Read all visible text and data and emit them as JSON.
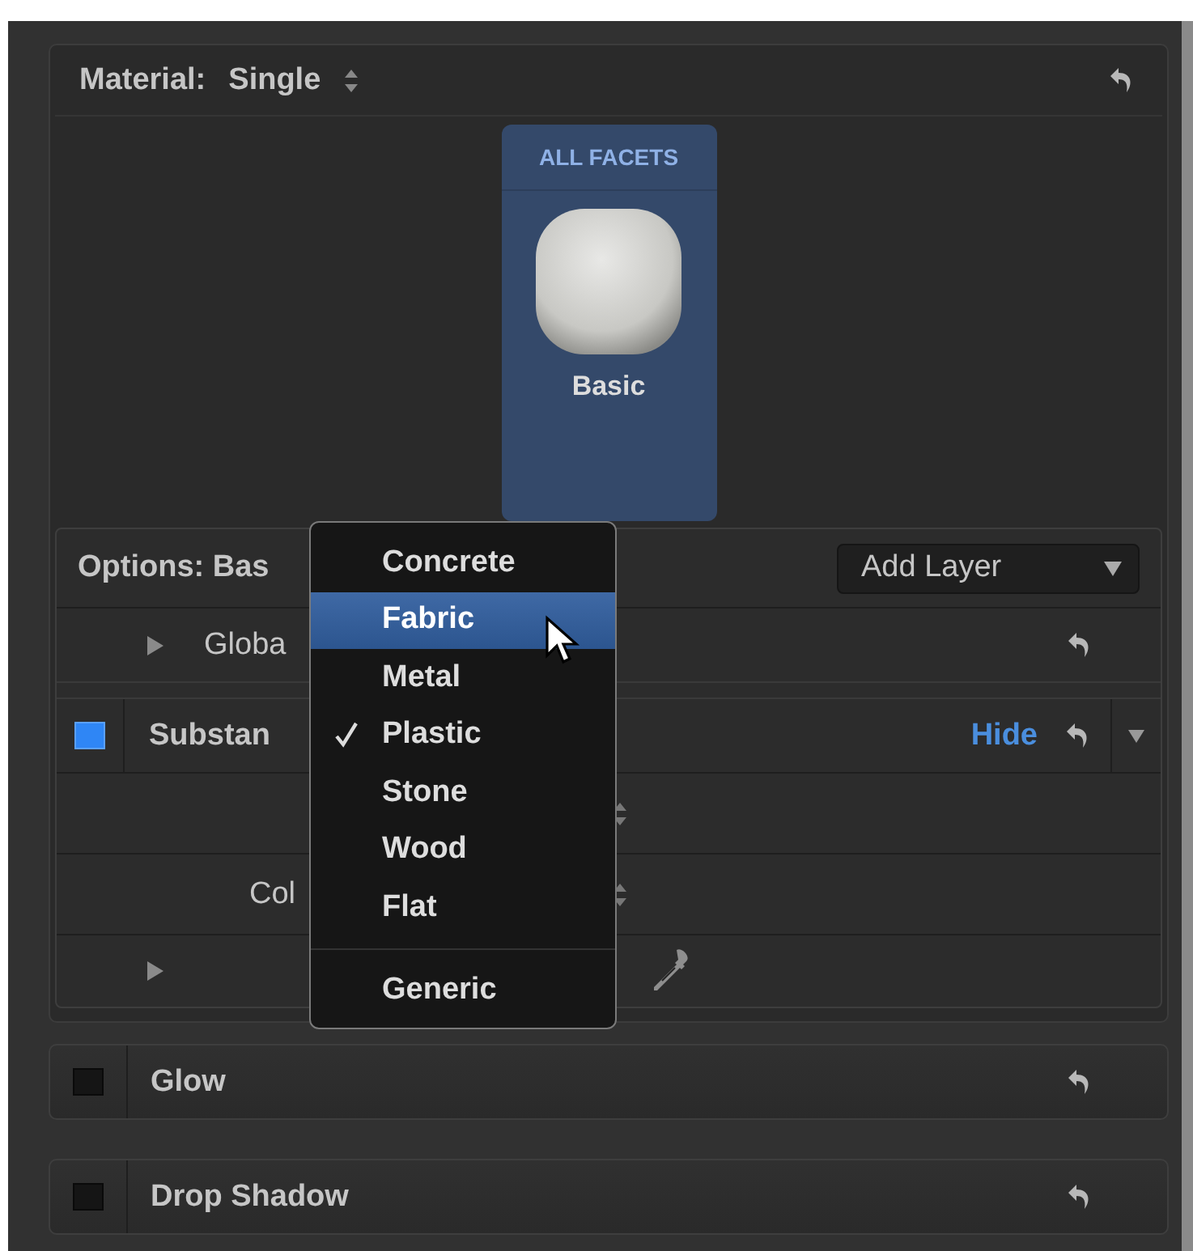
{
  "material": {
    "label": "Material:",
    "value": "Single",
    "tile": {
      "header": "ALL FACETS",
      "name": "Basic",
      "selected": true
    }
  },
  "options": {
    "label": "Options: Bas",
    "add_button": "Add Layer",
    "global": {
      "label": "Globa",
      "expanded": false
    },
    "substance": {
      "label": "Substan",
      "checked": true,
      "action": "Hide",
      "rows": [
        {
          "kind": "stepper"
        },
        {
          "kind": "stepper",
          "label": "Col"
        },
        {
          "kind": "eyedropper"
        }
      ]
    }
  },
  "menu": {
    "items": [
      {
        "kind": "item",
        "label": "Concrete",
        "highlighted": false,
        "checked": false
      },
      {
        "kind": "item",
        "label": "Fabric",
        "highlighted": true,
        "checked": false
      },
      {
        "kind": "item",
        "label": "Metal",
        "highlighted": false,
        "checked": false
      },
      {
        "kind": "item",
        "label": "Plastic",
        "highlighted": false,
        "checked": true
      },
      {
        "kind": "item",
        "label": "Stone",
        "highlighted": false,
        "checked": false
      },
      {
        "kind": "item",
        "label": "Wood",
        "highlighted": false,
        "checked": false
      },
      {
        "kind": "item",
        "label": "Flat",
        "highlighted": false,
        "checked": false
      },
      {
        "kind": "separator"
      },
      {
        "kind": "item",
        "label": "Generic",
        "highlighted": false,
        "checked": false
      }
    ]
  },
  "layers": [
    {
      "label": "Glow",
      "checked": false
    },
    {
      "label": "Drop Shadow",
      "checked": false
    }
  ]
}
